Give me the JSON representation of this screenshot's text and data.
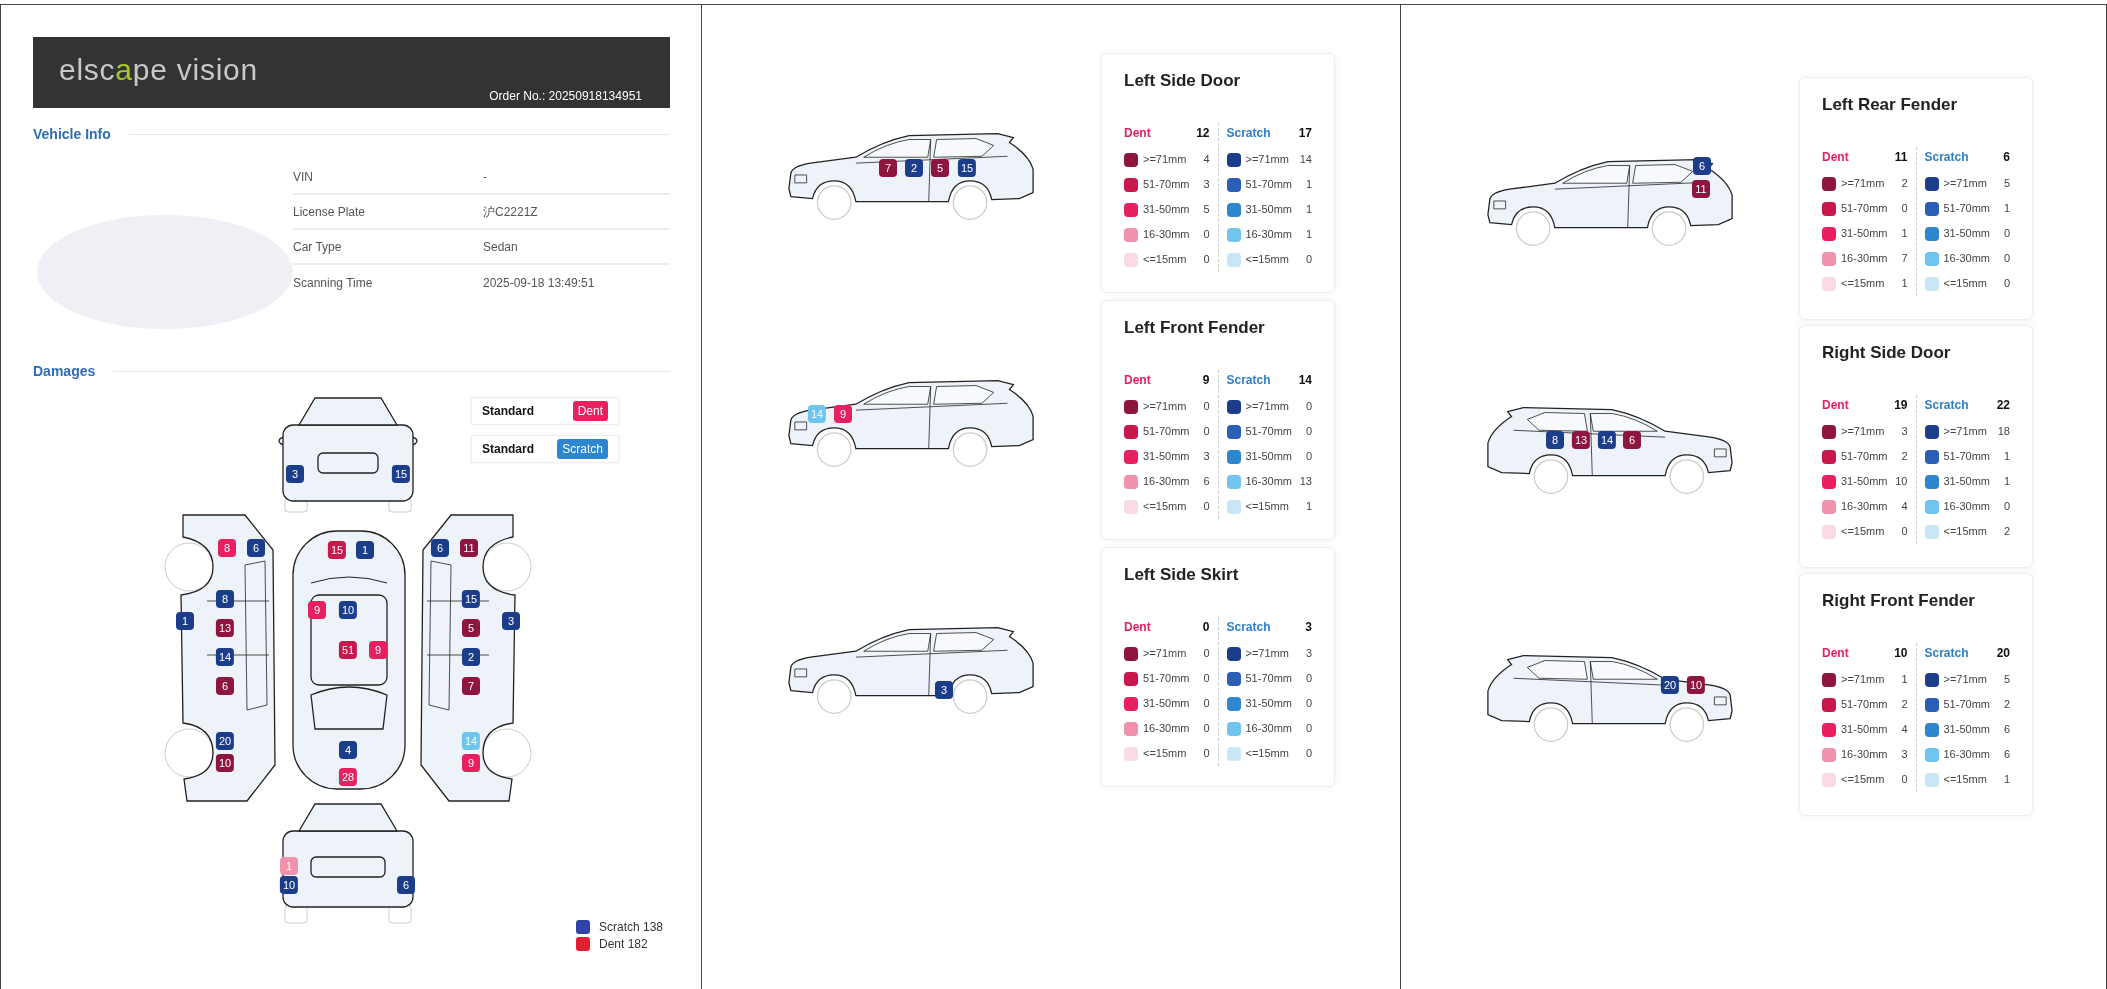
{
  "report": {
    "logo": {
      "before": "elsc",
      "accent": "a",
      "after": "pe vision"
    },
    "order_no": "Order No.: 20250918134951",
    "vehicle_info": {
      "title": "Vehicle Info",
      "rows": [
        {
          "label": "VIN",
          "value": "-"
        },
        {
          "label": "License Plate",
          "value": "沪C2221Z"
        },
        {
          "label": "Car Type",
          "value": "Sedan"
        },
        {
          "label": "Scanning Time",
          "value": "2025-09-18 13:49:51"
        }
      ]
    },
    "damages": {
      "title": "Damages",
      "standards": [
        {
          "label": "Standard",
          "badge": "Dent",
          "kind": "dent"
        },
        {
          "label": "Standard",
          "badge": "Scratch",
          "kind": "scratch"
        }
      ],
      "markers": [
        {
          "label": "3",
          "color": "#1b3d8a"
        },
        {
          "label": "15",
          "color": "#1b3d8a"
        },
        {
          "label": "8",
          "color": "#e8205f"
        },
        {
          "label": "6",
          "color": "#1b3d8a"
        },
        {
          "label": "8",
          "color": "#1b3d8a"
        },
        {
          "label": "1",
          "color": "#1b3d8a"
        },
        {
          "label": "13",
          "color": "#8e1540"
        },
        {
          "label": "14",
          "color": "#1b3d8a"
        },
        {
          "label": "6",
          "color": "#8e1540"
        },
        {
          "label": "20",
          "color": "#1b3d8a"
        },
        {
          "label": "10",
          "color": "#8e1540"
        },
        {
          "label": "15",
          "color": "#c8174a"
        },
        {
          "label": "1",
          "color": "#1b3d8a"
        },
        {
          "label": "9",
          "color": "#e8205f"
        },
        {
          "label": "10",
          "color": "#1b3d8a"
        },
        {
          "label": "51",
          "color": "#c8174a"
        },
        {
          "label": "9",
          "color": "#e8205f"
        },
        {
          "label": "4",
          "color": "#1b3d8a"
        },
        {
          "label": "28",
          "color": "#e8205f"
        },
        {
          "label": "6",
          "color": "#1b3d8a"
        },
        {
          "label": "11",
          "color": "#8e1540"
        },
        {
          "label": "15",
          "color": "#1b3d8a"
        },
        {
          "label": "3",
          "color": "#1b3d8a"
        },
        {
          "label": "5",
          "color": "#8e1540"
        },
        {
          "label": "2",
          "color": "#1b3d8a"
        },
        {
          "label": "7",
          "color": "#8e1540"
        },
        {
          "label": "14",
          "color": "#6ec6ef"
        },
        {
          "label": "9",
          "color": "#e8205f"
        },
        {
          "label": "1",
          "color": "#f092ac"
        },
        {
          "label": "10",
          "color": "#1b3d8a"
        },
        {
          "label": "6",
          "color": "#1b3d8a"
        }
      ],
      "totals": [
        {
          "label": "Scratch 138",
          "color": "#2f43a6"
        },
        {
          "label": "Dent 182",
          "color": "#e02030"
        }
      ]
    }
  },
  "pages": [
    {
      "sections": [
        {
          "car": {
            "kind": "left",
            "markers": [
              {
                "label": "7",
                "color": "#8e1540"
              },
              {
                "label": "2",
                "color": "#1b3d8a"
              },
              {
                "label": "5",
                "color": "#8e1540"
              },
              {
                "label": "15",
                "color": "#1b3d8a"
              }
            ]
          },
          "card": {
            "title": "Left Side Door",
            "columns": [
              {
                "kind": "dent",
                "label": "Dent",
                "total": "12",
                "rows": [
                  {
                    "color": "#8e1540",
                    "range": ">=71mm",
                    "count": "4"
                  },
                  {
                    "color": "#c8174a",
                    "range": "51-70mm",
                    "count": "3"
                  },
                  {
                    "color": "#e8205f",
                    "range": "31-50mm",
                    "count": "5"
                  },
                  {
                    "color": "#f092ac",
                    "range": "16-30mm",
                    "count": "0"
                  },
                  {
                    "color": "#fadbe4",
                    "range": "<=15mm",
                    "count": "0"
                  }
                ]
              },
              {
                "kind": "scratch",
                "label": "Scratch",
                "total": "17",
                "rows": [
                  {
                    "color": "#1b3d8a",
                    "range": ">=71mm",
                    "count": "14"
                  },
                  {
                    "color": "#2a5fb5",
                    "range": "51-70mm",
                    "count": "1"
                  },
                  {
                    "color": "#2e86cf",
                    "range": "31-50mm",
                    "count": "1"
                  },
                  {
                    "color": "#6ec6ef",
                    "range": "16-30mm",
                    "count": "1"
                  },
                  {
                    "color": "#c9e6f7",
                    "range": "<=15mm",
                    "count": "0"
                  }
                ]
              }
            ]
          }
        },
        {
          "car": {
            "kind": "left",
            "markers": [
              {
                "label": "14",
                "color": "#6ec6ef"
              },
              {
                "label": "9",
                "color": "#e8205f"
              }
            ]
          },
          "card": {
            "title": "Left Front Fender",
            "columns": [
              {
                "kind": "dent",
                "label": "Dent",
                "total": "9",
                "rows": [
                  {
                    "color": "#8e1540",
                    "range": ">=71mm",
                    "count": "0"
                  },
                  {
                    "color": "#c8174a",
                    "range": "51-70mm",
                    "count": "0"
                  },
                  {
                    "color": "#e8205f",
                    "range": "31-50mm",
                    "count": "3"
                  },
                  {
                    "color": "#f092ac",
                    "range": "16-30mm",
                    "count": "6"
                  },
                  {
                    "color": "#fadbe4",
                    "range": "<=15mm",
                    "count": "0"
                  }
                ]
              },
              {
                "kind": "scratch",
                "label": "Scratch",
                "total": "14",
                "rows": [
                  {
                    "color": "#1b3d8a",
                    "range": ">=71mm",
                    "count": "0"
                  },
                  {
                    "color": "#2a5fb5",
                    "range": "51-70mm",
                    "count": "0"
                  },
                  {
                    "color": "#2e86cf",
                    "range": "31-50mm",
                    "count": "0"
                  },
                  {
                    "color": "#6ec6ef",
                    "range": "16-30mm",
                    "count": "13"
                  },
                  {
                    "color": "#c9e6f7",
                    "range": "<=15mm",
                    "count": "1"
                  }
                ]
              }
            ]
          }
        },
        {
          "car": {
            "kind": "left",
            "markers": [
              {
                "label": "3",
                "color": "#1b3d8a"
              }
            ]
          },
          "card": {
            "title": "Left Side Skirt",
            "columns": [
              {
                "kind": "dent",
                "label": "Dent",
                "total": "0",
                "rows": [
                  {
                    "color": "#8e1540",
                    "range": ">=71mm",
                    "count": "0"
                  },
                  {
                    "color": "#c8174a",
                    "range": "51-70mm",
                    "count": "0"
                  },
                  {
                    "color": "#e8205f",
                    "range": "31-50mm",
                    "count": "0"
                  },
                  {
                    "color": "#f092ac",
                    "range": "16-30mm",
                    "count": "0"
                  },
                  {
                    "color": "#fadbe4",
                    "range": "<=15mm",
                    "count": "0"
                  }
                ]
              },
              {
                "kind": "scratch",
                "label": "Scratch",
                "total": "3",
                "rows": [
                  {
                    "color": "#1b3d8a",
                    "range": ">=71mm",
                    "count": "3"
                  },
                  {
                    "color": "#2a5fb5",
                    "range": "51-70mm",
                    "count": "0"
                  },
                  {
                    "color": "#2e86cf",
                    "range": "31-50mm",
                    "count": "0"
                  },
                  {
                    "color": "#6ec6ef",
                    "range": "16-30mm",
                    "count": "0"
                  },
                  {
                    "color": "#c9e6f7",
                    "range": "<=15mm",
                    "count": "0"
                  }
                ]
              }
            ]
          }
        }
      ]
    },
    {
      "sections": [
        {
          "car": {
            "kind": "left",
            "markers": [
              {
                "label": "6",
                "color": "#1b3d8a"
              },
              {
                "label": "11",
                "color": "#8e1540"
              }
            ]
          },
          "card": {
            "title": "Left Rear Fender",
            "columns": [
              {
                "kind": "dent",
                "label": "Dent",
                "total": "11",
                "rows": [
                  {
                    "color": "#8e1540",
                    "range": ">=71mm",
                    "count": "2"
                  },
                  {
                    "color": "#c8174a",
                    "range": "51-70mm",
                    "count": "0"
                  },
                  {
                    "color": "#e8205f",
                    "range": "31-50mm",
                    "count": "1"
                  },
                  {
                    "color": "#f092ac",
                    "range": "16-30mm",
                    "count": "7"
                  },
                  {
                    "color": "#fadbe4",
                    "range": "<=15mm",
                    "count": "1"
                  }
                ]
              },
              {
                "kind": "scratch",
                "label": "Scratch",
                "total": "6",
                "rows": [
                  {
                    "color": "#1b3d8a",
                    "range": ">=71mm",
                    "count": "5"
                  },
                  {
                    "color": "#2a5fb5",
                    "range": "51-70mm",
                    "count": "1"
                  },
                  {
                    "color": "#2e86cf",
                    "range": "31-50mm",
                    "count": "0"
                  },
                  {
                    "color": "#6ec6ef",
                    "range": "16-30mm",
                    "count": "0"
                  },
                  {
                    "color": "#c9e6f7",
                    "range": "<=15mm",
                    "count": "0"
                  }
                ]
              }
            ]
          }
        },
        {
          "car": {
            "kind": "right",
            "markers": [
              {
                "label": "8",
                "color": "#1b3d8a"
              },
              {
                "label": "13",
                "color": "#8e1540"
              },
              {
                "label": "14",
                "color": "#1b3d8a"
              },
              {
                "label": "6",
                "color": "#8e1540"
              }
            ]
          },
          "card": {
            "title": "Right Side Door",
            "columns": [
              {
                "kind": "dent",
                "label": "Dent",
                "total": "19",
                "rows": [
                  {
                    "color": "#8e1540",
                    "range": ">=71mm",
                    "count": "3"
                  },
                  {
                    "color": "#c8174a",
                    "range": "51-70mm",
                    "count": "2"
                  },
                  {
                    "color": "#e8205f",
                    "range": "31-50mm",
                    "count": "10"
                  },
                  {
                    "color": "#f092ac",
                    "range": "16-30mm",
                    "count": "4"
                  },
                  {
                    "color": "#fadbe4",
                    "range": "<=15mm",
                    "count": "0"
                  }
                ]
              },
              {
                "kind": "scratch",
                "label": "Scratch",
                "total": "22",
                "rows": [
                  {
                    "color": "#1b3d8a",
                    "range": ">=71mm",
                    "count": "18"
                  },
                  {
                    "color": "#2a5fb5",
                    "range": "51-70mm",
                    "count": "1"
                  },
                  {
                    "color": "#2e86cf",
                    "range": "31-50mm",
                    "count": "1"
                  },
                  {
                    "color": "#6ec6ef",
                    "range": "16-30mm",
                    "count": "0"
                  },
                  {
                    "color": "#c9e6f7",
                    "range": "<=15mm",
                    "count": "2"
                  }
                ]
              }
            ]
          }
        },
        {
          "car": {
            "kind": "right",
            "markers": [
              {
                "label": "20",
                "color": "#1b3d8a"
              },
              {
                "label": "10",
                "color": "#8e1540"
              }
            ]
          },
          "card": {
            "title": "Right Front Fender",
            "columns": [
              {
                "kind": "dent",
                "label": "Dent",
                "total": "10",
                "rows": [
                  {
                    "color": "#8e1540",
                    "range": ">=71mm",
                    "count": "1"
                  },
                  {
                    "color": "#c8174a",
                    "range": "51-70mm",
                    "count": "2"
                  },
                  {
                    "color": "#e8205f",
                    "range": "31-50mm",
                    "count": "4"
                  },
                  {
                    "color": "#f092ac",
                    "range": "16-30mm",
                    "count": "3"
                  },
                  {
                    "color": "#fadbe4",
                    "range": "<=15mm",
                    "count": "0"
                  }
                ]
              },
              {
                "kind": "scratch",
                "label": "Scratch",
                "total": "20",
                "rows": [
                  {
                    "color": "#1b3d8a",
                    "range": ">=71mm",
                    "count": "5"
                  },
                  {
                    "color": "#2a5fb5",
                    "range": "51-70mm",
                    "count": "2"
                  },
                  {
                    "color": "#2e86cf",
                    "range": "31-50mm",
                    "count": "6"
                  },
                  {
                    "color": "#6ec6ef",
                    "range": "16-30mm",
                    "count": "6"
                  },
                  {
                    "color": "#c9e6f7",
                    "range": "<=15mm",
                    "count": "1"
                  }
                ]
              }
            ]
          }
        }
      ]
    }
  ]
}
